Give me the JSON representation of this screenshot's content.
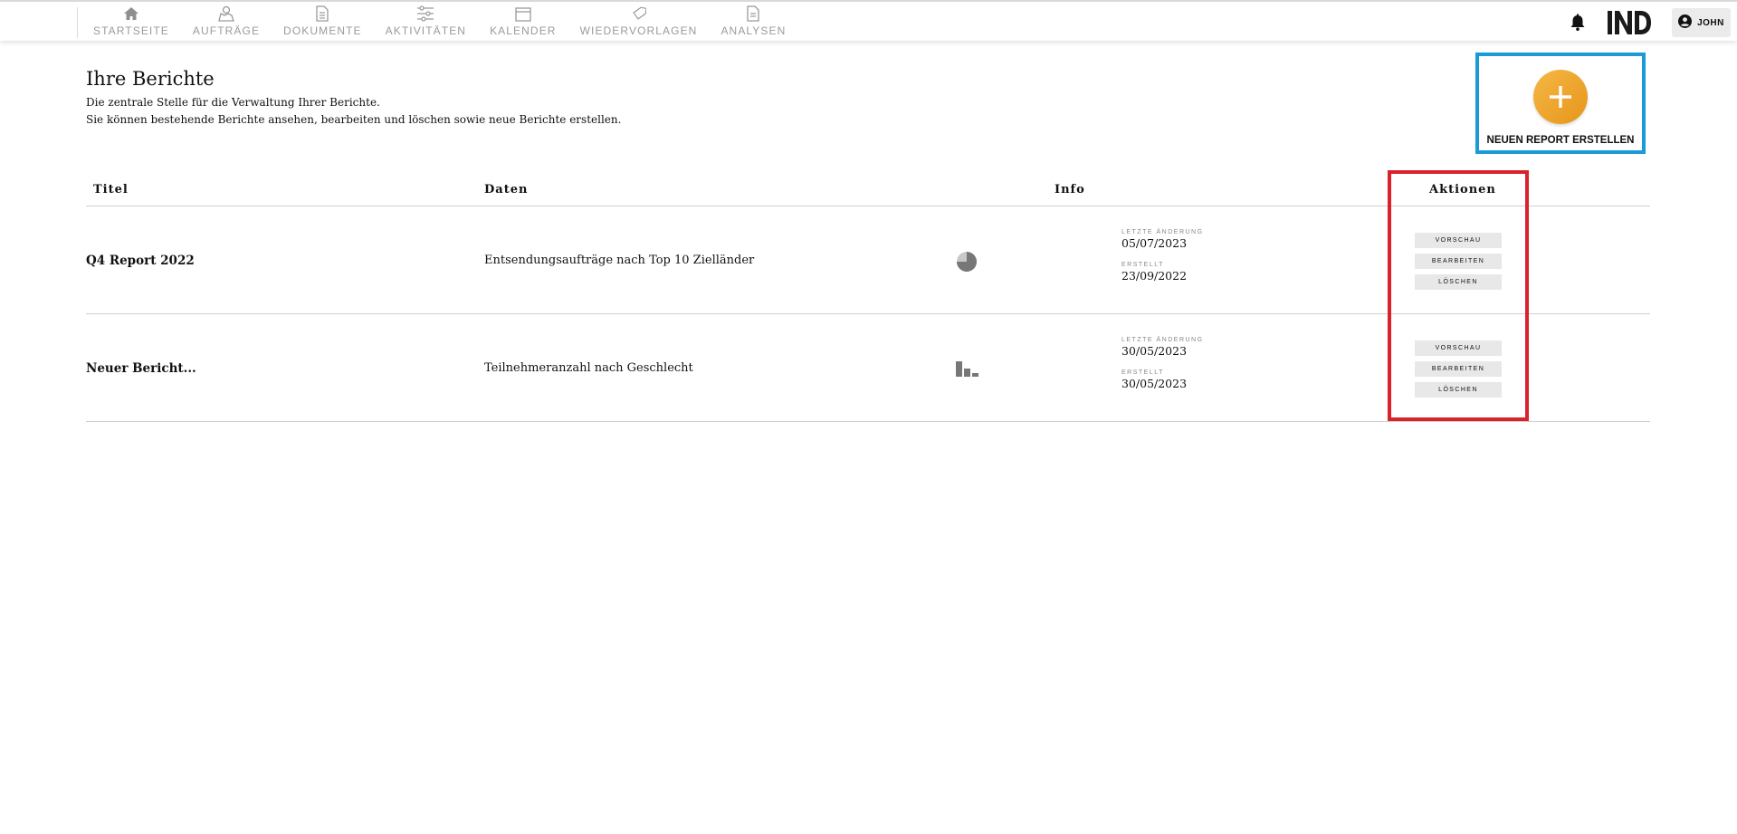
{
  "nav": {
    "items": [
      {
        "label": "STARTSEITE",
        "icon": "home-icon"
      },
      {
        "label": "AUFTRÄGE",
        "icon": "orders-icon"
      },
      {
        "label": "DOKUMENTE",
        "icon": "document-icon"
      },
      {
        "label": "AKTIVITÄTEN",
        "icon": "sliders-icon"
      },
      {
        "label": "KALENDER",
        "icon": "calendar-icon"
      },
      {
        "label": "WIEDERVORLAGEN",
        "icon": "tag-icon"
      },
      {
        "label": "ANALYSEN",
        "icon": "report-icon"
      }
    ],
    "user": "JOHN",
    "logo": "IND"
  },
  "header": {
    "title": "Ihre Berichte",
    "description_line1": "Die zentrale Stelle für die Verwaltung Ihrer Berichte.",
    "description_line2": "Sie können bestehende Berichte ansehen, bearbeiten und löschen sowie neue Berichte erstellen.",
    "new_report_label": "NEUEN REPORT ERSTELLEN"
  },
  "table": {
    "columns": {
      "title": "Titel",
      "data": "Daten",
      "info": "Info",
      "actions": "Aktionen"
    },
    "info_labels": {
      "modified": "LETZTE ÄNDERUNG",
      "created": "ERSTELLT"
    },
    "action_labels": {
      "preview": "VORSCHAU",
      "edit": "BEARBEITEN",
      "delete": "LÖSCHEN"
    },
    "rows": [
      {
        "title": "Q4 Report 2022",
        "data": "Entsendungsaufträge nach Top 10 Zielländer",
        "chart_icon": "pie-chart-icon",
        "modified": "05/07/2023",
        "created": "23/09/2022"
      },
      {
        "title": "Neuer Bericht...",
        "data": "Teilnehmeranzahl nach Geschlecht",
        "chart_icon": "bar-chart-icon",
        "modified": "30/05/2023",
        "created": "30/05/2023"
      }
    ]
  },
  "colors": {
    "accent_orange": "#eda32e",
    "highlight_blue": "#1a9ad6",
    "highlight_red": "#d9222a"
  }
}
